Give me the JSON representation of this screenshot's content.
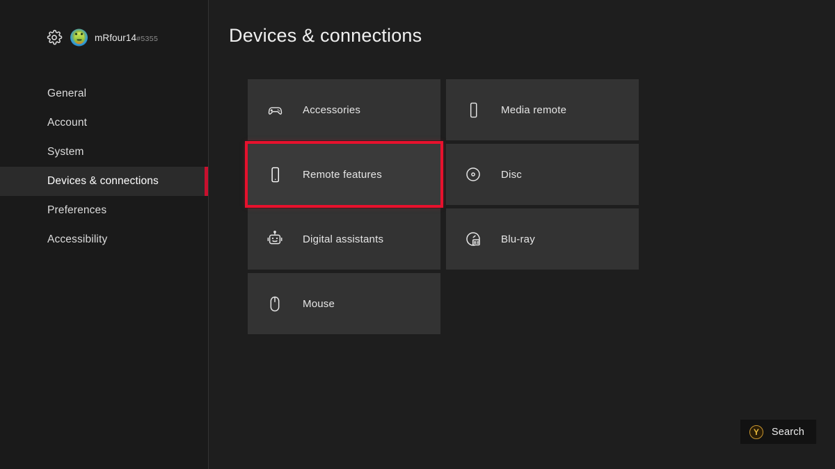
{
  "sidebar": {
    "gear_icon": "gear-icon",
    "avatar_icon": "avatar",
    "gamertag": "mRfour14",
    "gamertag_suffix": "#5355",
    "items": [
      {
        "label": "General",
        "selected": false
      },
      {
        "label": "Account",
        "selected": false
      },
      {
        "label": "System",
        "selected": false
      },
      {
        "label": "Devices & connections",
        "selected": true
      },
      {
        "label": "Preferences",
        "selected": false
      },
      {
        "label": "Accessibility",
        "selected": false
      }
    ]
  },
  "main": {
    "title": "Devices & connections",
    "tiles": [
      {
        "label": "Accessories",
        "icon": "gamepad-icon",
        "focused": false
      },
      {
        "label": "Media remote",
        "icon": "remote-icon",
        "focused": false
      },
      {
        "label": "Remote features",
        "icon": "phone-icon",
        "focused": true
      },
      {
        "label": "Disc",
        "icon": "disc-icon",
        "focused": false
      },
      {
        "label": "Digital assistants",
        "icon": "robot-icon",
        "focused": false
      },
      {
        "label": "Blu-ray",
        "icon": "bluray-icon",
        "focused": false
      },
      {
        "label": "Mouse",
        "icon": "mouse-icon",
        "focused": false
      }
    ]
  },
  "footer": {
    "search_button_glyph": "Y",
    "search_label": "Search"
  },
  "colors": {
    "background": "#1e1e1e",
    "sidebar": "#1a1a1a",
    "tile": "#333333",
    "selected_row": "#2b2b2b",
    "accent_red": "#c8102e",
    "focus_red": "#e8112d",
    "y_button": "#e8b93c"
  }
}
